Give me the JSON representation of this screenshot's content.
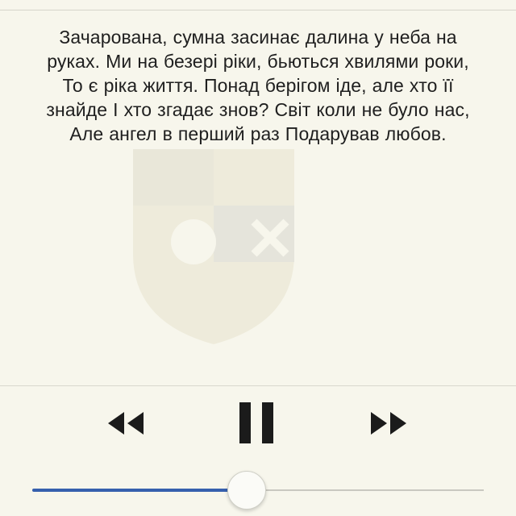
{
  "lyrics": {
    "lines": [
      "Зачарована, сумна засинає далина у неба на",
      "руках. Ми на безері ріки, бьються хвилями роки,",
      "То є ріка життя. Понад берігом іде, але хто її",
      "знайде І хто згадає знов? Світ коли не було нас,",
      "Але ангел в перший раз Подарував любов."
    ]
  },
  "controls": {
    "rewind_icon": "rewind-icon",
    "pause_icon": "pause-icon",
    "forward_icon": "fast-forward-icon"
  },
  "playback": {
    "progress_fraction": 0.475
  },
  "colors": {
    "background": "#f7f6ec",
    "text": "#1f1f1f",
    "icon": "#1b1b1b",
    "progress_elapsed": "#3660ad",
    "progress_remaining": "#c9c8c0"
  }
}
